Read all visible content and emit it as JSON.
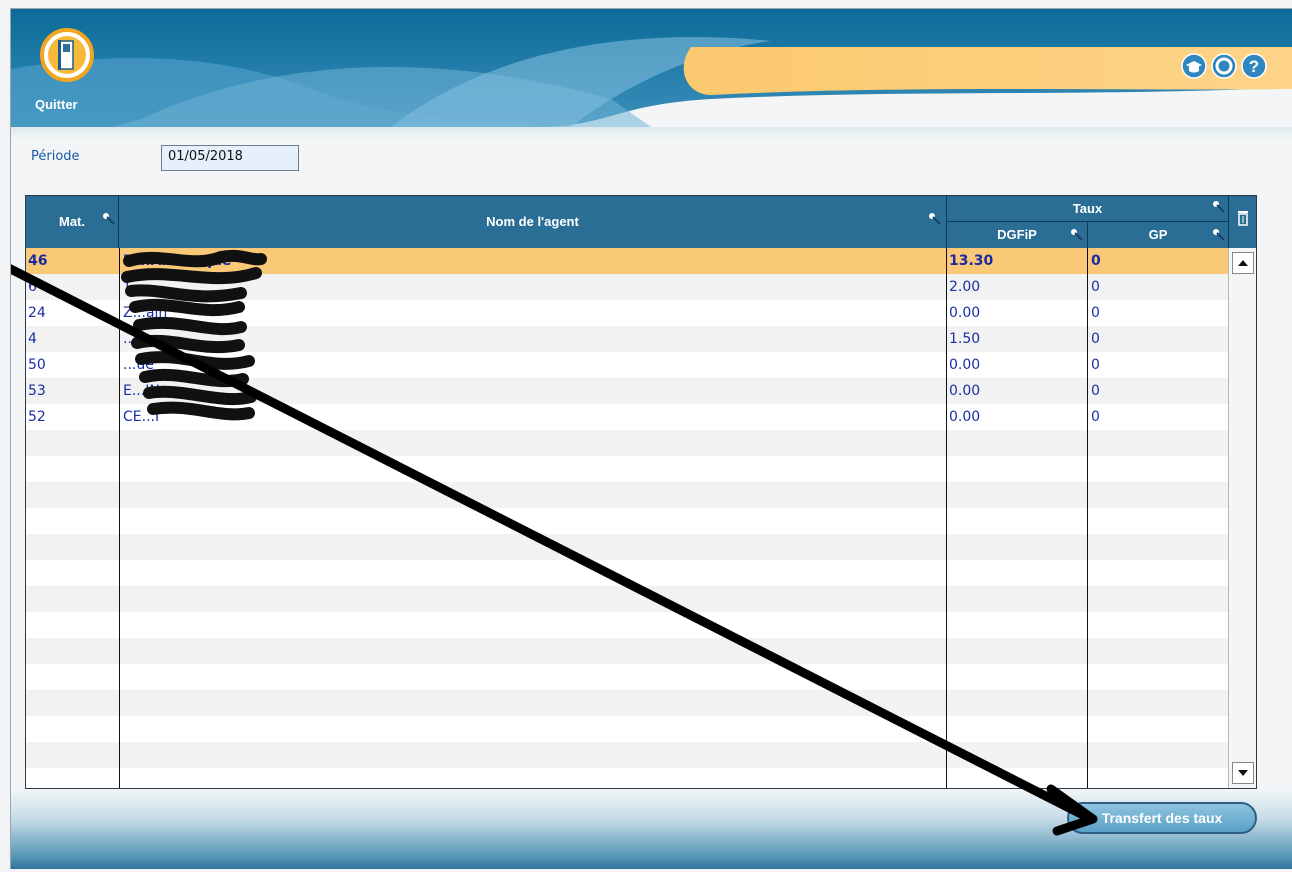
{
  "header": {
    "quit_label": "Quitter",
    "icons": [
      "graduation-cap-icon",
      "support-icon",
      "help-icon"
    ]
  },
  "period": {
    "label": "Période",
    "value": "01/05/2018"
  },
  "grid": {
    "headers": {
      "mat": "Mat.",
      "name": "Nom de l'agent",
      "taux": "Taux",
      "dgfip": "DGFiP",
      "gp": "GP"
    },
    "rows": [
      {
        "mat": "46",
        "name": "D...ART ...que",
        "dgfip": "13.30",
        "gp": "0"
      },
      {
        "mat": "6",
        "name": "T...",
        "dgfip": "2.00",
        "gp": "0"
      },
      {
        "mat": "24",
        "name": "Z...ain",
        "dgfip": "0.00",
        "gp": "0"
      },
      {
        "mat": "4",
        "name": "...",
        "dgfip": "1.50",
        "gp": "0"
      },
      {
        "mat": "50",
        "name": "...ue",
        "dgfip": "0.00",
        "gp": "0"
      },
      {
        "mat": "53",
        "name": "E...IN...",
        "dgfip": "0.00",
        "gp": "0"
      },
      {
        "mat": "52",
        "name": "CE...I",
        "dgfip": "0.00",
        "gp": "0"
      }
    ]
  },
  "footer": {
    "transfer_label": "Transfert des taux"
  },
  "colors": {
    "header_blue": "#2a6e96",
    "selected_row": "#fac978",
    "text_blue": "#1a2fa6",
    "banner_orange": "#fbc96e"
  }
}
